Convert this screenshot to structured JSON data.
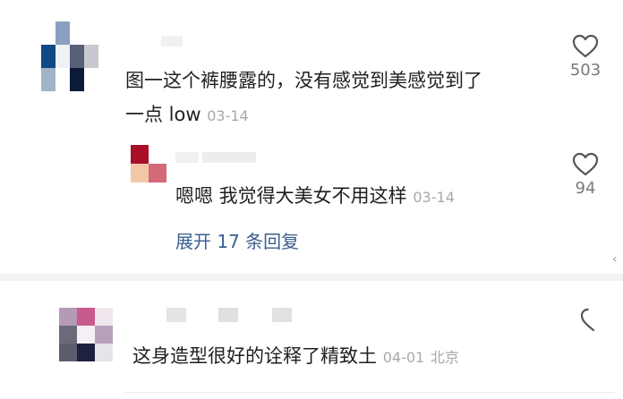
{
  "comments": [
    {
      "text_line1": "图一这个裤腰露的，没有感觉到美感觉到了",
      "text_line2": "一点 low",
      "date": "03-14",
      "likes": "503",
      "avatar_colors": [
        "#ffffff",
        "#8aa0c0",
        "#ffffff",
        "#ffffff",
        "#0e4a84",
        "#eef2f7",
        "#5a5f78",
        "#c8c8d0",
        "#a0b3c8",
        "#ffffff",
        "#0c1a3a",
        "#ffffff"
      ],
      "reply": {
        "text": "嗯嗯 我觉得大美女不用这样",
        "date": "03-14",
        "likes": "94",
        "avatar_colors": [
          "#a8102a",
          "#ffffff",
          "#f2c7a8",
          "#d46a78"
        ]
      },
      "expand_label": "展开 17 条回复"
    },
    {
      "text": "这身造型很好的诠释了精致土",
      "date": "04-01",
      "location": "北京",
      "avatar_colors": [
        "#b59ab8",
        "#c85a8e",
        "#efe6ee",
        "#6a6a7a",
        "#f5f0f4",
        "#b7a0bc",
        "#5c5c6c",
        "#1e2240",
        "#e6e3ea"
      ]
    }
  ],
  "icons": {
    "like": "heart-outline-icon"
  },
  "colors": {
    "link": "#3b5f8f",
    "meta": "#a8a8a8",
    "text": "#1f1f1f"
  }
}
